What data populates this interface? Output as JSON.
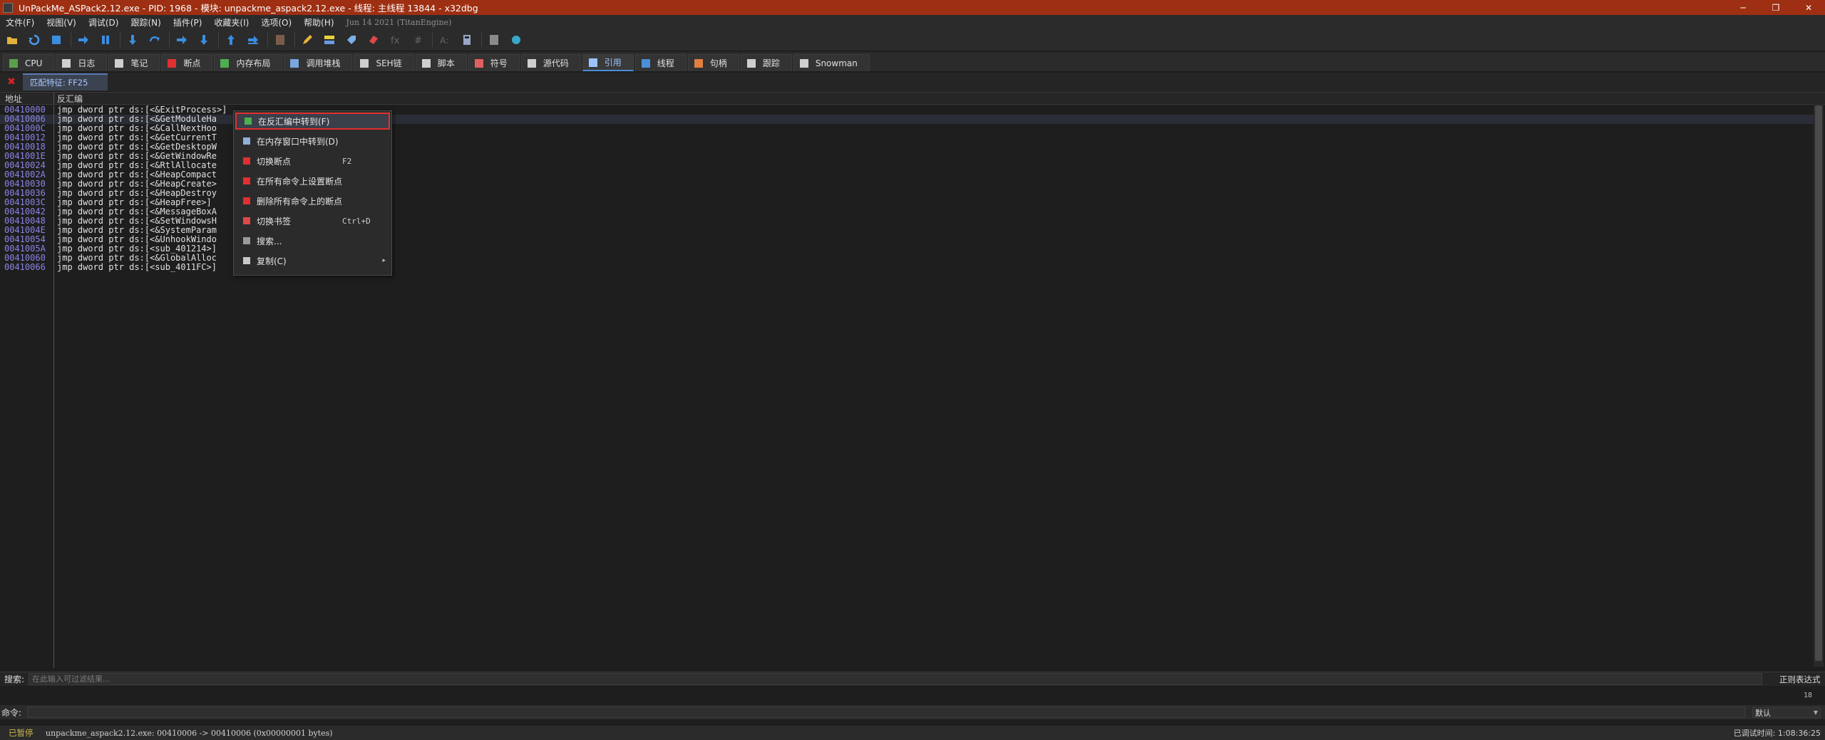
{
  "titlebar": {
    "title": "UnPackMe_ASPack2.12.exe - PID: 1968 - 模块: unpackme_aspack2.12.exe - 线程: 主线程 13844 - x32dbg",
    "minimize": "─",
    "restore": "❐",
    "close": "✕"
  },
  "menubar": {
    "items": [
      "文件(F)",
      "视图(V)",
      "调试(D)",
      "跟踪(N)",
      "插件(P)",
      "收藏夹(I)",
      "选项(O)",
      "帮助(H)"
    ],
    "build": "Jun 14 2021 (TitanEngine)"
  },
  "tabs": [
    {
      "label": "CPU",
      "icon": "cpu-icon",
      "color": "#5aa04a"
    },
    {
      "label": "日志",
      "icon": "log-icon",
      "color": "#cfcfcf"
    },
    {
      "label": "笔记",
      "icon": "notes-icon",
      "color": "#cfcfcf"
    },
    {
      "label": "断点",
      "icon": "breakpoint-icon",
      "color": "#e03030"
    },
    {
      "label": "内存布局",
      "icon": "memory-map-icon",
      "color": "#4caf50"
    },
    {
      "label": "调用堆栈",
      "icon": "call-stack-icon",
      "color": "#7aa6e0"
    },
    {
      "label": "SEH链",
      "icon": "seh-icon",
      "color": "#cfcfcf"
    },
    {
      "label": "脚本",
      "icon": "script-icon",
      "color": "#cfcfcf"
    },
    {
      "label": "符号",
      "icon": "symbols-icon",
      "color": "#e06060"
    },
    {
      "label": "源代码",
      "icon": "source-icon",
      "color": "#cfcfcf"
    },
    {
      "label": "引用",
      "icon": "references-icon",
      "color": "#9bc4ff"
    },
    {
      "label": "线程",
      "icon": "threads-icon",
      "color": "#4a8fd8"
    },
    {
      "label": "句柄",
      "icon": "handles-icon",
      "color": "#e08040"
    },
    {
      "label": "跟踪",
      "icon": "trace-icon",
      "color": "#cfcfcf"
    },
    {
      "label": "Snowman",
      "icon": "snowman-icon",
      "color": "#cfcfcf"
    }
  ],
  "active_tab": "引用",
  "subtab": {
    "label": "匹配特征: FF25"
  },
  "table": {
    "columns": [
      "地址",
      "反汇编"
    ],
    "rows": [
      {
        "addr": "00410000",
        "dis": "jmp dword ptr ds:[<&ExitProcess>]"
      },
      {
        "addr": "00410006",
        "dis": "jmp dword ptr ds:[<&GetModuleHa"
      },
      {
        "addr": "0041000C",
        "dis": "jmp dword ptr ds:[<&CallNextHoo"
      },
      {
        "addr": "00410012",
        "dis": "jmp dword ptr ds:[<&GetCurrentT"
      },
      {
        "addr": "00410018",
        "dis": "jmp dword ptr ds:[<&GetDesktopW"
      },
      {
        "addr": "0041001E",
        "dis": "jmp dword ptr ds:[<&GetWindowRe"
      },
      {
        "addr": "00410024",
        "dis": "jmp dword ptr ds:[<&RtlAllocate"
      },
      {
        "addr": "0041002A",
        "dis": "jmp dword ptr ds:[<&HeapCompact"
      },
      {
        "addr": "00410030",
        "dis": "jmp dword ptr ds:[<&HeapCreate>"
      },
      {
        "addr": "00410036",
        "dis": "jmp dword ptr ds:[<&HeapDestroy"
      },
      {
        "addr": "0041003C",
        "dis": "jmp dword ptr ds:[<&HeapFree>]"
      },
      {
        "addr": "00410042",
        "dis": "jmp dword ptr ds:[<&MessageBoxA"
      },
      {
        "addr": "00410048",
        "dis": "jmp dword ptr ds:[<&SetWindowsH"
      },
      {
        "addr": "0041004E",
        "dis": "jmp dword ptr ds:[<&SystemParam"
      },
      {
        "addr": "00410054",
        "dis": "jmp dword ptr ds:[<&UnhookWindo"
      },
      {
        "addr": "0041005A",
        "dis": "jmp dword ptr ds:[<sub_401214>]"
      },
      {
        "addr": "00410060",
        "dis": "jmp dword ptr ds:[<&GlobalAlloc"
      },
      {
        "addr": "00410066",
        "dis": "jmp dword ptr ds:[<sub_4011FC>]"
      }
    ]
  },
  "context_menu": {
    "items": [
      {
        "label": "在反汇编中转到(F)",
        "shortcut": "",
        "icon": "goto-disasm-icon",
        "highlighted": true
      },
      {
        "label": "在内存窗口中转到(D)",
        "shortcut": "",
        "icon": "goto-dump-icon"
      },
      {
        "label": "切换断点",
        "shortcut": "F2",
        "icon": "toggle-breakpoint-icon"
      },
      {
        "label": "在所有命令上设置断点",
        "shortcut": "",
        "icon": "set-all-breakpoints-icon"
      },
      {
        "label": "删除所有命令上的断点",
        "shortcut": "",
        "icon": "remove-all-breakpoints-icon"
      },
      {
        "label": "切换书签",
        "shortcut": "Ctrl+D",
        "icon": "bookmark-icon"
      },
      {
        "label": "搜索...",
        "shortcut": "",
        "icon": "search-icon"
      },
      {
        "label": "复制(C)",
        "shortcut": "",
        "icon": "copy-icon",
        "submenu": true
      }
    ]
  },
  "search": {
    "label": "搜索:",
    "placeholder": "在此输入可过滤结果...",
    "regex_label": "正则表达式"
  },
  "result_count": "18",
  "command": {
    "label": "命令:",
    "value": "",
    "engine": "默认"
  },
  "status": {
    "state": "已暂停",
    "message": "unpackme_aspack2.12.exe: 00410006 -> 00410006 (0x00000001 bytes)",
    "time": "已调试时间: 1:08:36:25"
  }
}
